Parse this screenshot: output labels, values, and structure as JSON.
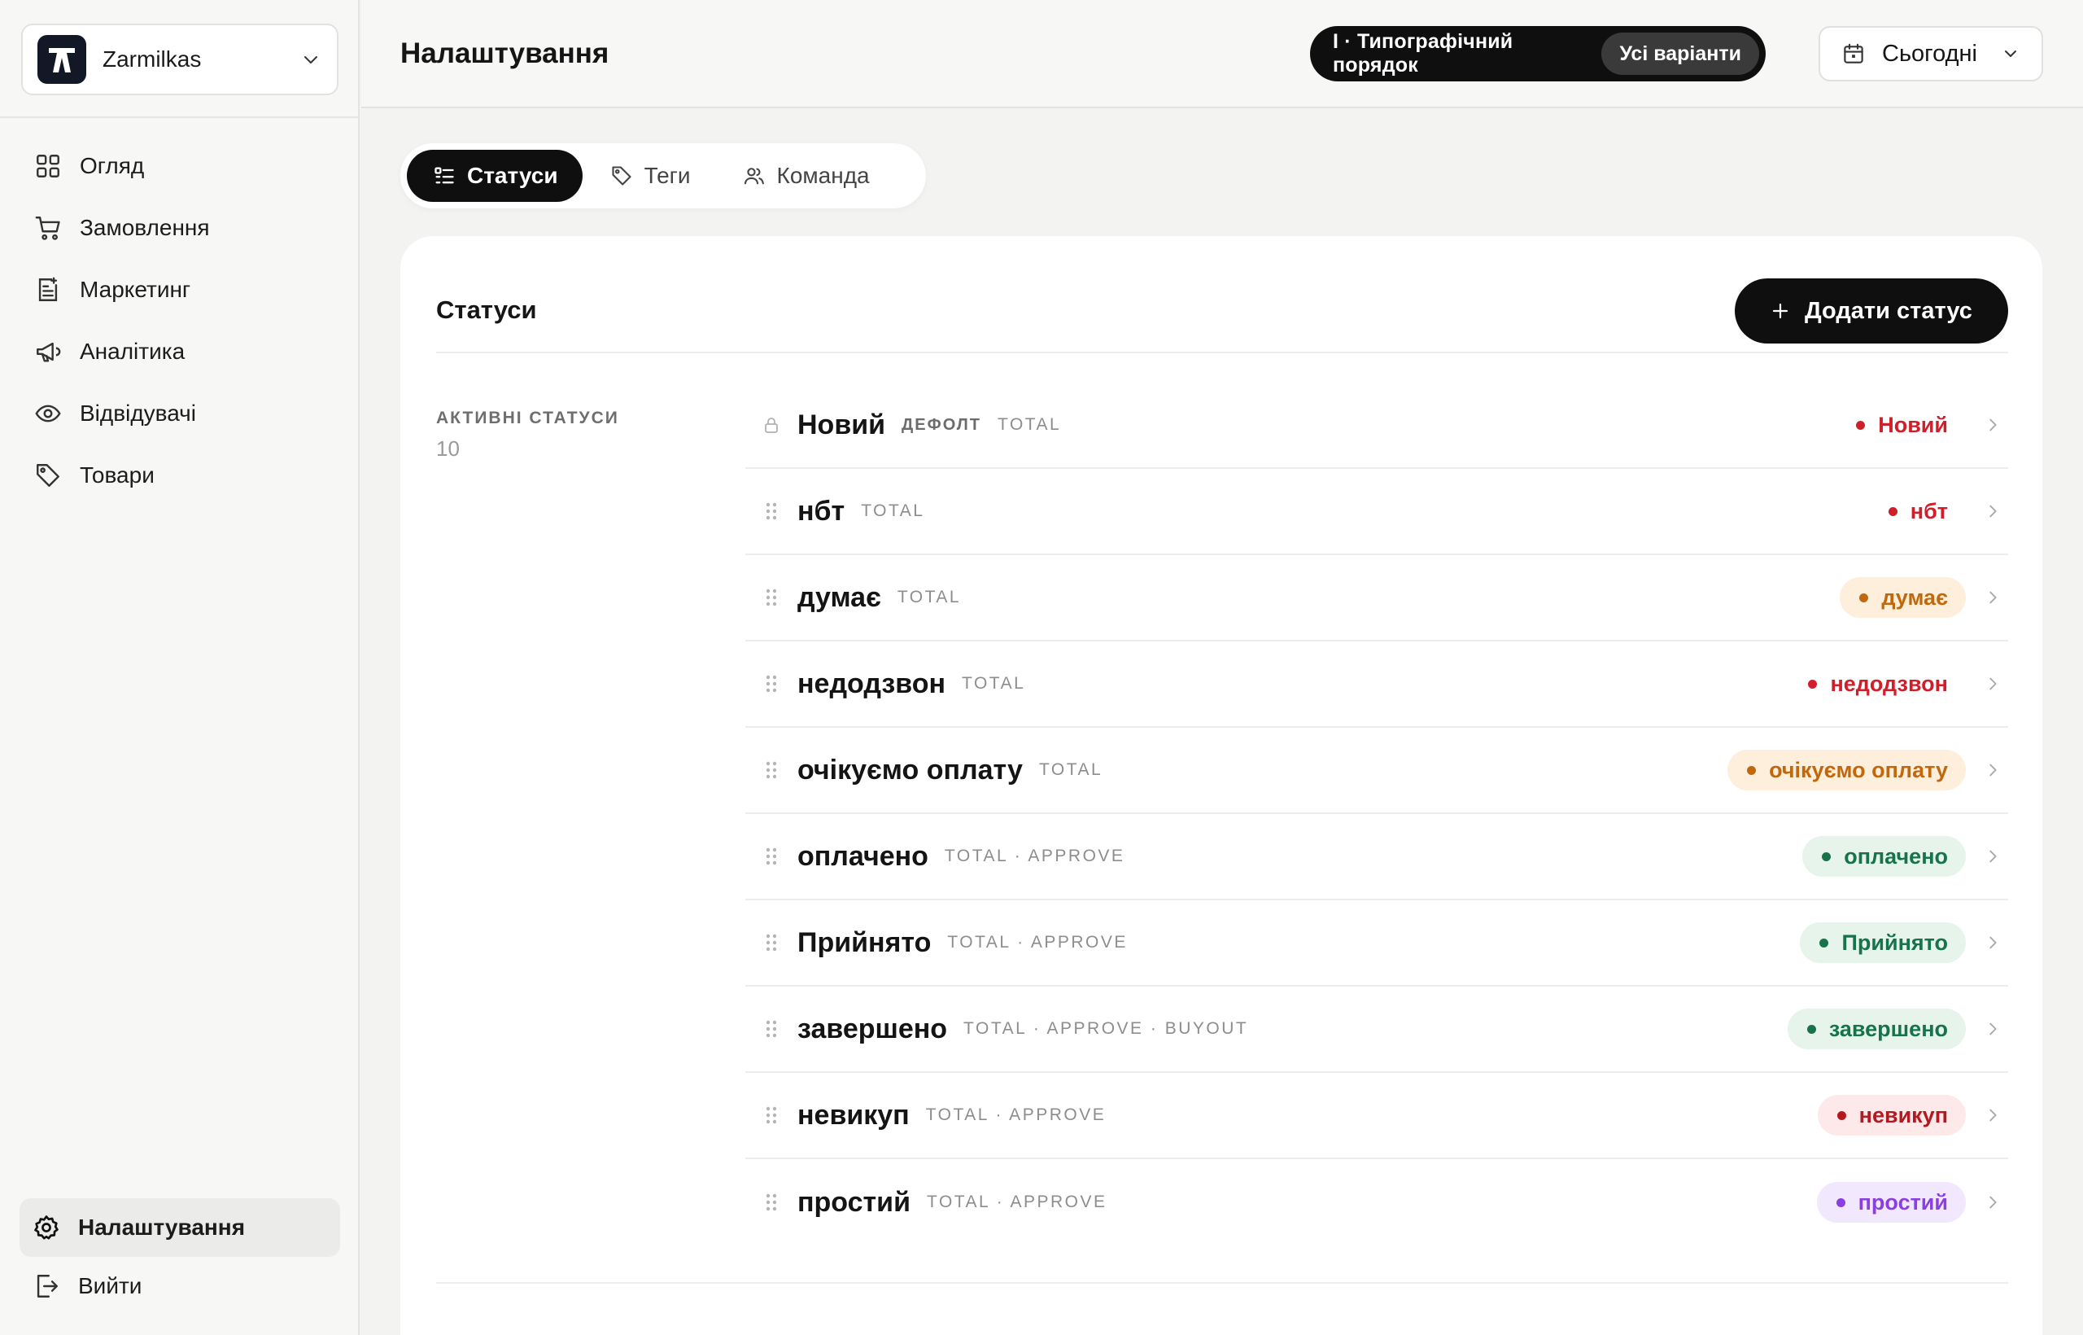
{
  "workspace": {
    "name": "Zarmilkas"
  },
  "nav": {
    "items": [
      {
        "label": "Огляд",
        "icon": "grid-icon"
      },
      {
        "label": "Замовлення",
        "icon": "cart-icon"
      },
      {
        "label": "Маркетинг",
        "icon": "document-list-icon"
      },
      {
        "label": "Аналітика",
        "icon": "megaphone-icon"
      },
      {
        "label": "Відвідувачі",
        "icon": "eye-icon"
      },
      {
        "label": "Товари",
        "icon": "tag-icon"
      }
    ],
    "settings_label": "Налаштування",
    "logout_label": "Вийти"
  },
  "header": {
    "title": "Налаштування",
    "order_label": "I · Типографічний порядок",
    "order_all": "Усі варіанти",
    "date_label": "Сьогодні"
  },
  "tabs": [
    {
      "label": "Статуси",
      "active": true
    },
    {
      "label": "Теги",
      "active": false
    },
    {
      "label": "Команда",
      "active": false
    }
  ],
  "card": {
    "title": "Статуси",
    "add_button": "Додати статус",
    "section_label": "АКТИВНІ СТАТУСИ",
    "section_count": "10"
  },
  "colors": {
    "red": "#d01f2a",
    "orange": "#c2680c",
    "orange_bg": "#fdefdc",
    "green": "#17734a",
    "green_bg": "#e6f4ec",
    "darkred": "#b01a20",
    "red_bg": "#fde9ea",
    "purple": "#8a3fe0",
    "purple_bg": "#f1e8fd"
  },
  "statuses": [
    {
      "name": "Новий",
      "default": "ДЕФОЛТ",
      "meta": "TOTAL",
      "badge": "Новий",
      "locked": true
    },
    {
      "name": "нбт",
      "default": "",
      "meta": "TOTAL",
      "badge": "нбт",
      "locked": false
    },
    {
      "name": "думає",
      "default": "",
      "meta": "TOTAL",
      "badge": "думає",
      "locked": false
    },
    {
      "name": "недодзвон",
      "default": "",
      "meta": "TOTAL",
      "badge": "недодзвон",
      "locked": false
    },
    {
      "name": "очікуємо оплату",
      "default": "",
      "meta": "TOTAL",
      "badge": "очікуємо оплату",
      "locked": false
    },
    {
      "name": "оплачено",
      "default": "",
      "meta": "TOTAL · APPROVE",
      "badge": "оплачено",
      "locked": false
    },
    {
      "name": "Прийнято",
      "default": "",
      "meta": "TOTAL · APPROVE",
      "badge": "Прийнято",
      "locked": false
    },
    {
      "name": "завершено",
      "default": "",
      "meta": "TOTAL · APPROVE · BUYOUT",
      "badge": "завершено",
      "locked": false
    },
    {
      "name": "невикуп",
      "default": "",
      "meta": "TOTAL · APPROVE",
      "badge": "невикуп",
      "locked": false
    },
    {
      "name": "простий",
      "default": "",
      "meta": "TOTAL · APPROVE",
      "badge": "простий",
      "locked": false
    }
  ]
}
